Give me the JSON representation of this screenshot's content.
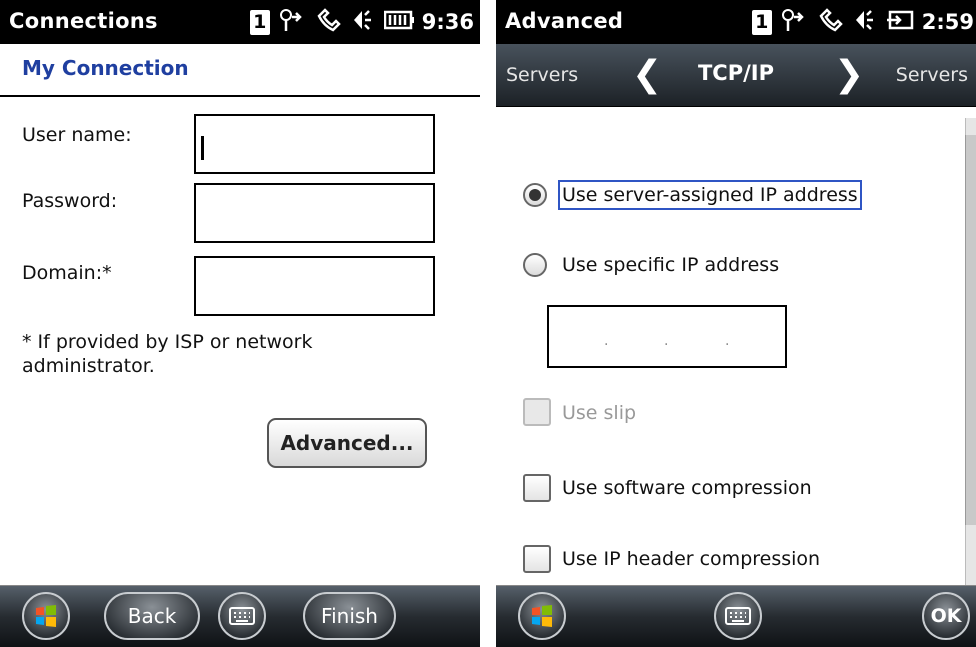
{
  "left": {
    "status": {
      "title": "Connections",
      "sim": "1",
      "time": "9:36"
    },
    "header": {
      "title": "My Connection"
    },
    "fields": {
      "username_label": "User name:",
      "username_value": "",
      "password_label": "Password:",
      "password_value": "",
      "domain_label": "Domain:*",
      "domain_value": ""
    },
    "note": "* If provided by ISP or network administrator.",
    "advanced_button": "Advanced...",
    "bottom": {
      "back": "Back",
      "finish": "Finish"
    }
  },
  "right": {
    "status": {
      "title": "Advanced",
      "sim": "1",
      "time": "2:59"
    },
    "nav": {
      "prev": "Servers",
      "current": "TCP/IP",
      "next": "Servers"
    },
    "options": {
      "server_assigned": "Use server-assigned IP address",
      "specific_ip": "Use specific IP address",
      "ip_value": ". . .",
      "slip": "Use slip",
      "software_compression": "Use software compression",
      "ip_header_compression": "Use IP header compression"
    },
    "state": {
      "selected_radio": "server_assigned",
      "slip_disabled": true
    },
    "bottom": {
      "ok": "OK"
    }
  },
  "icons": [
    "sim-icon",
    "signal-icon",
    "phone-icon",
    "volume-icon",
    "battery-icon",
    "windows-icon",
    "keyboard-icon",
    "chevron-left-icon",
    "chevron-right-icon"
  ],
  "colors": {
    "header_blue": "#1f3fa0",
    "focus_blue": "#2f55c4",
    "bar_dark": "#262b30"
  }
}
